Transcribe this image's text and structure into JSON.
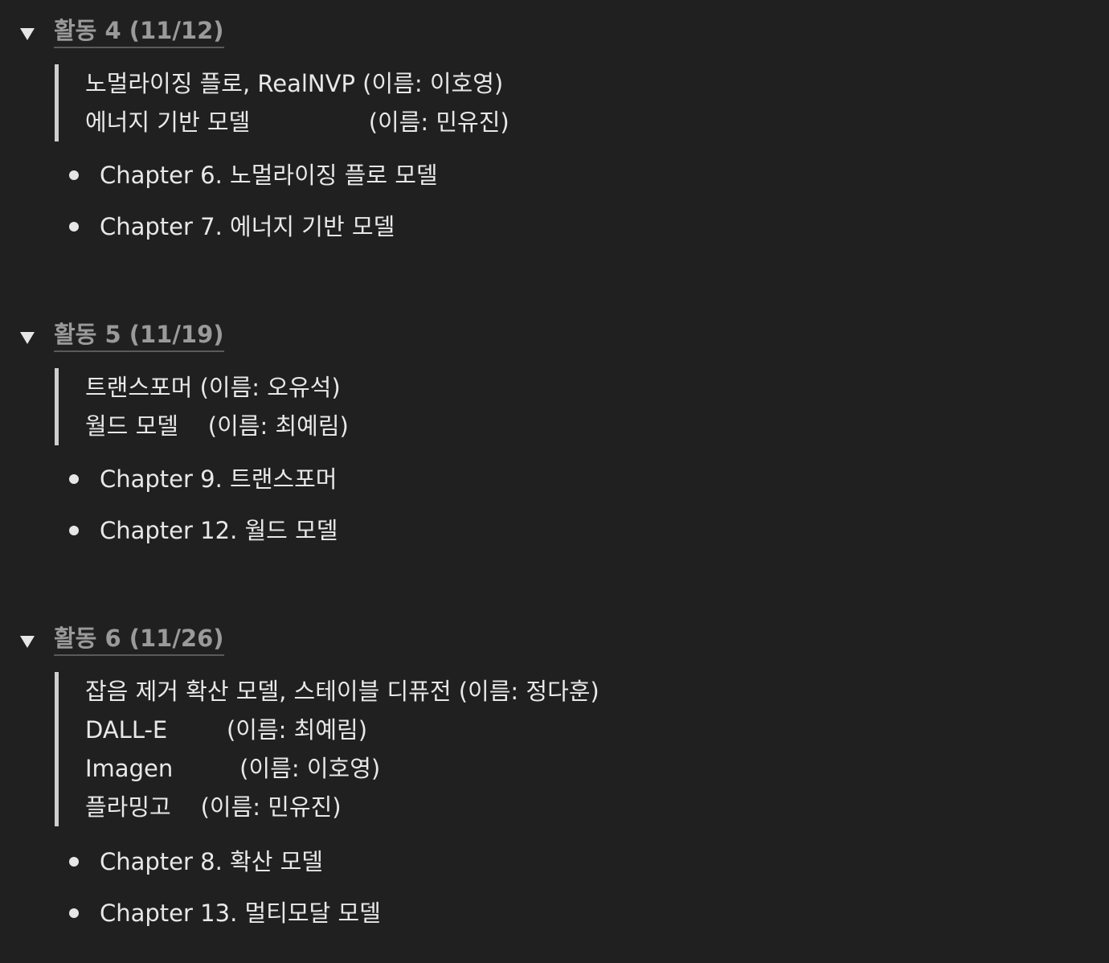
{
  "sections": [
    {
      "title": "활동 4 (11/12)",
      "quote": [
        "노멀라이징 플로, RealNVP (이름: 이호영)",
        "에너지 기반 모델                (이름: 민유진)"
      ],
      "bullets": [
        "Chapter 6. 노멀라이징 플로 모델",
        "Chapter 7. 에너지 기반 모델"
      ]
    },
    {
      "title": "활동 5 (11/19)",
      "quote": [
        "트랜스포머 (이름: 오유석)",
        "월드 모델    (이름: 최예림)"
      ],
      "bullets": [
        "Chapter 9. 트랜스포머",
        "Chapter 12. 월드 모델"
      ]
    },
    {
      "title": "활동 6 (11/26)",
      "quote": [
        "잡음 제거 확산 모델, 스테이블 디퓨전 (이름: 정다훈)",
        "DALL-E        (이름: 최예림)",
        "Imagen         (이름: 이호영)",
        "플라밍고    (이름: 민유진)"
      ],
      "bullets": [
        "Chapter 8. 확산 모델",
        "Chapter 13. 멀티모달 모델"
      ]
    }
  ],
  "colors": {
    "background": "#202020",
    "toggle_title": "#9a9a9a",
    "text": "#e8e8e8",
    "quote_bar": "#cfcfcf"
  },
  "icons": {
    "toggle": "triangle-down-icon",
    "bullet": "bullet-dot-icon"
  }
}
